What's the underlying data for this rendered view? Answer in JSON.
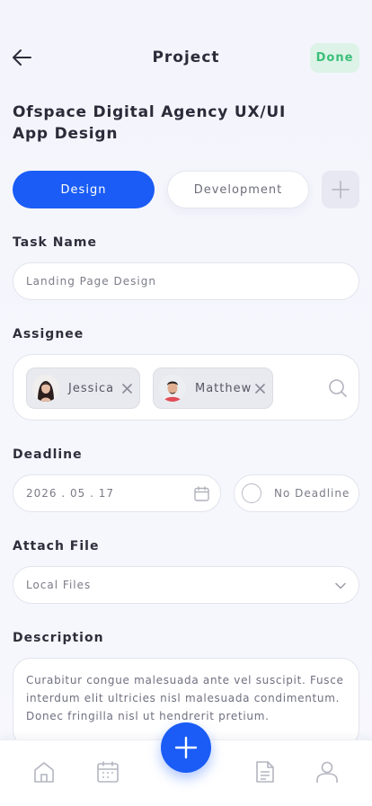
{
  "header": {
    "title": "Project",
    "done_label": "Done"
  },
  "project": {
    "title": "Ofspace Digital Agency UX/UI App Design"
  },
  "tabs": [
    {
      "label": "Design",
      "active": true
    },
    {
      "label": "Development",
      "active": false
    }
  ],
  "task_name": {
    "label": "Task Name",
    "value": "Landing Page Design"
  },
  "assignee": {
    "label": "Assignee",
    "people": [
      {
        "name": "Jessica"
      },
      {
        "name": "Matthew"
      }
    ]
  },
  "deadline": {
    "label": "Deadline",
    "date": "2026 . 05 . 17",
    "no_deadline_label": "No Deadline"
  },
  "attach": {
    "label": "Attach File",
    "value": "Local Files"
  },
  "description": {
    "label": "Description",
    "text": "Curabitur congue malesuada ante vel suscipit. Fusce interdum elit ultricies nisl malesuada condimentum. Donec fringilla nisl ut hendrerit pretium."
  },
  "colors": {
    "accent": "#1a5cf5",
    "done_bg": "#ddf3e8",
    "done_text": "#3bbf78"
  },
  "bottom_nav": [
    "home-icon",
    "calendar-icon",
    "add-icon",
    "document-icon",
    "profile-icon"
  ]
}
